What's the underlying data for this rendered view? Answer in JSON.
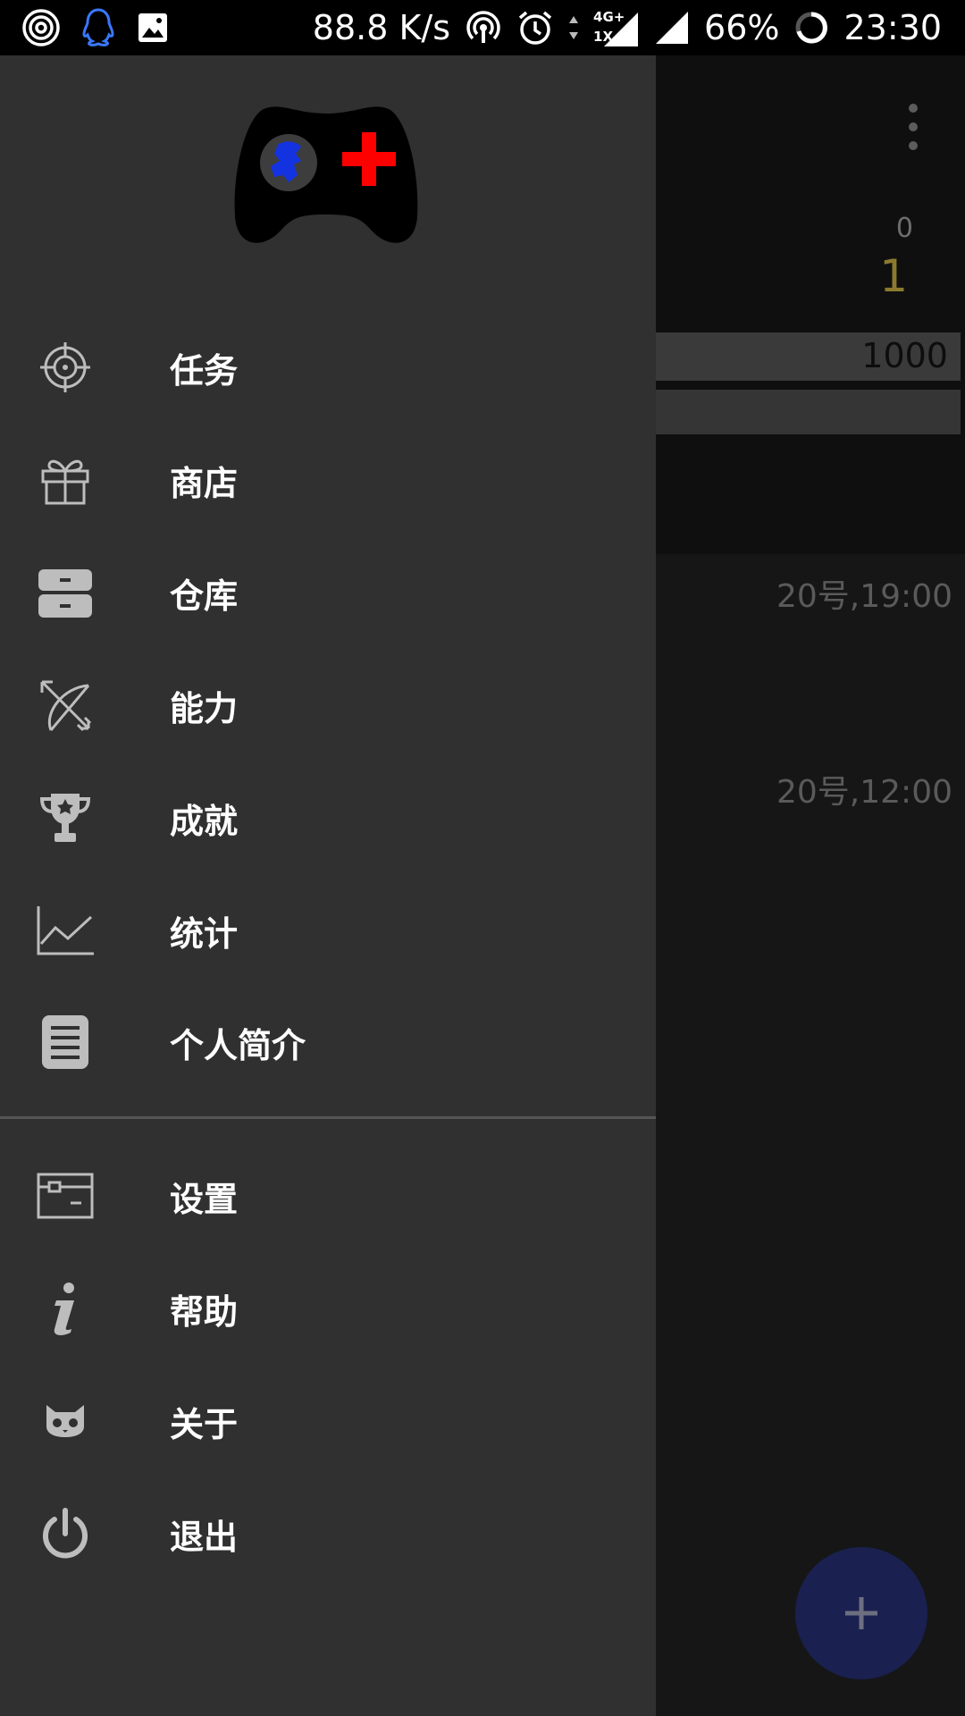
{
  "status_bar": {
    "net_speed": "88.8 K/s",
    "net_type_top": "4G+",
    "net_type_bottom": "1X",
    "battery": "66%",
    "time": "23:30"
  },
  "background": {
    "level_small": "0",
    "level_big": "1",
    "bar_value": "1000",
    "list_times": [
      "20号,19:00",
      "20号,12:00"
    ],
    "fab_icon": "plus-icon"
  },
  "drawer": {
    "logo": "gamepad-logo",
    "menu_items": [
      {
        "label": "任务",
        "icon": "target-icon"
      },
      {
        "label": "商店",
        "icon": "gift-icon"
      },
      {
        "label": "仓库",
        "icon": "storage-icon"
      },
      {
        "label": "能力",
        "icon": "bow-arrow-icon"
      },
      {
        "label": "成就",
        "icon": "trophy-icon"
      },
      {
        "label": "统计",
        "icon": "chart-icon"
      },
      {
        "label": "个人简介",
        "icon": "profile-doc-icon"
      }
    ],
    "secondary_items": [
      {
        "label": "设置",
        "icon": "settings-icon"
      },
      {
        "label": "帮助",
        "icon": "info-icon"
      },
      {
        "label": "关于",
        "icon": "cat-icon"
      },
      {
        "label": "退出",
        "icon": "power-icon"
      }
    ]
  },
  "colors": {
    "drawer_bg": "#303030",
    "logo_red": "#ff0000",
    "logo_blue": "#1433e0",
    "accent_gold": "#8c7a2e",
    "fab": "#1a2150"
  }
}
